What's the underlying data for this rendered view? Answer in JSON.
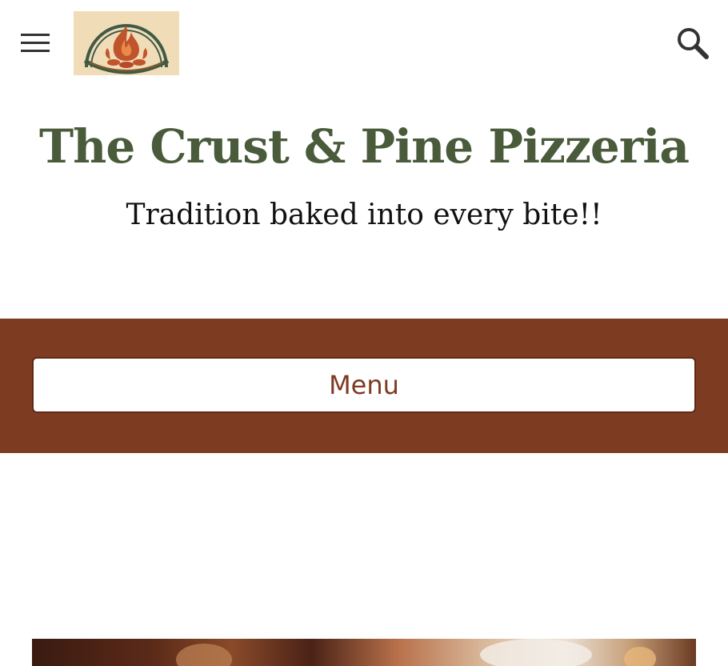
{
  "header": {
    "menu_icon": "hamburger-menu-icon",
    "logo_icon": "wood-fired-oven-logo",
    "search_icon": "search-icon"
  },
  "site": {
    "title": "The Crust & Pine Pizzeria",
    "tagline": "Tradition baked into every bite!!"
  },
  "nav": {
    "menu_label": "Menu"
  },
  "colors": {
    "title": "#4a5b3b",
    "band": "#7d3b22",
    "logo_bg": "#f1dcb8",
    "flame": "#c0542a",
    "logo_green": "#3f5a45"
  }
}
